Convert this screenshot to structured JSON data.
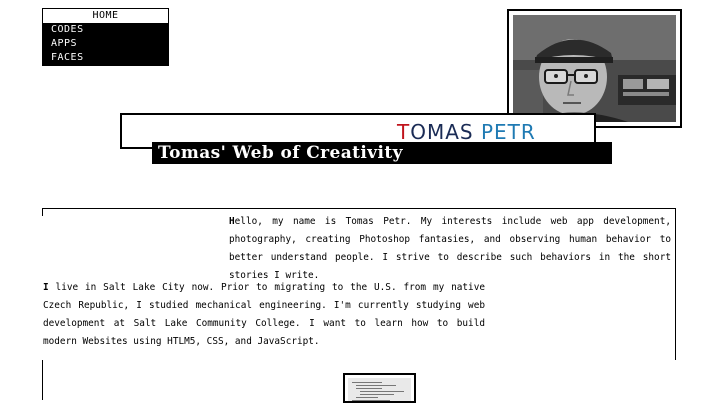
{
  "nav": {
    "items": [
      {
        "label": "HOME",
        "active": true
      },
      {
        "label": "CODES",
        "active": false
      },
      {
        "label": "APPS",
        "active": false
      },
      {
        "label": "FACES",
        "active": false
      }
    ]
  },
  "header": {
    "name_part1": "T",
    "name_part2": "OMAS ",
    "name_part3": "PETR",
    "tagline": "Tomas' Web of Creativity"
  },
  "intro": {
    "para1_first": "H",
    "para1_rest": "ello, my name is Tomas Petr. My interests include web app development, photography, creating Photoshop fantasies, and observing human behavior to better understand people. I strive to describe such behaviors in the short stories I write.",
    "para2_first": "I",
    "para2_rest": " live in Salt Lake City now. Prior to migrating to the U.S. from my native Czech Republic, I studied mechanical engineering. I'm currently studying web development at Salt Lake Community College. I want to learn how to build modern Websites using HTLM5, CSS, and JavaScript."
  },
  "colors": {
    "name_red": "#c0141c",
    "name_navy": "#1a2b55",
    "name_blue": "#1f7ab3"
  }
}
